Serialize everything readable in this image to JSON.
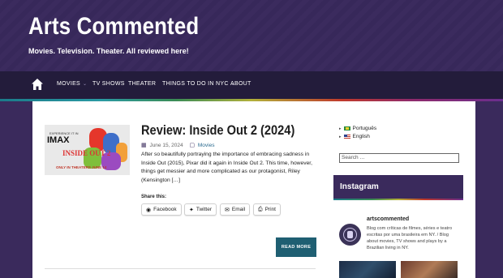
{
  "site": {
    "title": "Arts Commented",
    "tagline": "Movies. Television. Theater. All reviewed here!"
  },
  "nav": {
    "items": [
      {
        "label": "MOVIES",
        "has_dropdown": true
      },
      {
        "label": "TV SHOWS",
        "has_dropdown": false
      },
      {
        "label": "THEATER",
        "has_dropdown": false
      },
      {
        "label": "THINGS TO DO IN NYC",
        "has_dropdown": true
      },
      {
        "label": "ABOUT",
        "has_dropdown": false
      }
    ]
  },
  "post": {
    "title": "Review: Inside Out 2 (2024)",
    "date": "June 15, 2024",
    "category": "Movies",
    "excerpt": "After so beautifully portraying the importance of embracing sadness in Inside Out (2015), Pixar did it again in Inside Out 2. This time, however, things get messier and more complicated as our protagonist, Riley (Kensington […]",
    "thumbnail": {
      "brand": "IMAX",
      "subtitle": "EXPERIENCE IT IN",
      "film": "INSIDE OUT 2",
      "release": "ONLY IN THEATERS JUNE 14"
    },
    "share_label": "Share this:",
    "share_buttons": [
      "Facebook",
      "Twitter",
      "Email",
      "Print"
    ],
    "read_more": "READ MORE"
  },
  "sidebar": {
    "languages": [
      {
        "label": "Português",
        "flag": "br"
      },
      {
        "label": "English",
        "flag": "us"
      }
    ],
    "search_placeholder": "Search …",
    "instagram": {
      "heading": "Instagram",
      "username": "artscommented",
      "bio": "Blog com críticas de filmes, séries e teatro escritas por uma brasileira em NY. / Blog about movies, TV shows and plays by a Brazilian living in NY."
    }
  },
  "colors": {
    "header_bg": "#3a2a5c",
    "nav_bg": "#231c3b",
    "read_more_bg": "#1f5f72",
    "link": "#2b6b8f"
  }
}
